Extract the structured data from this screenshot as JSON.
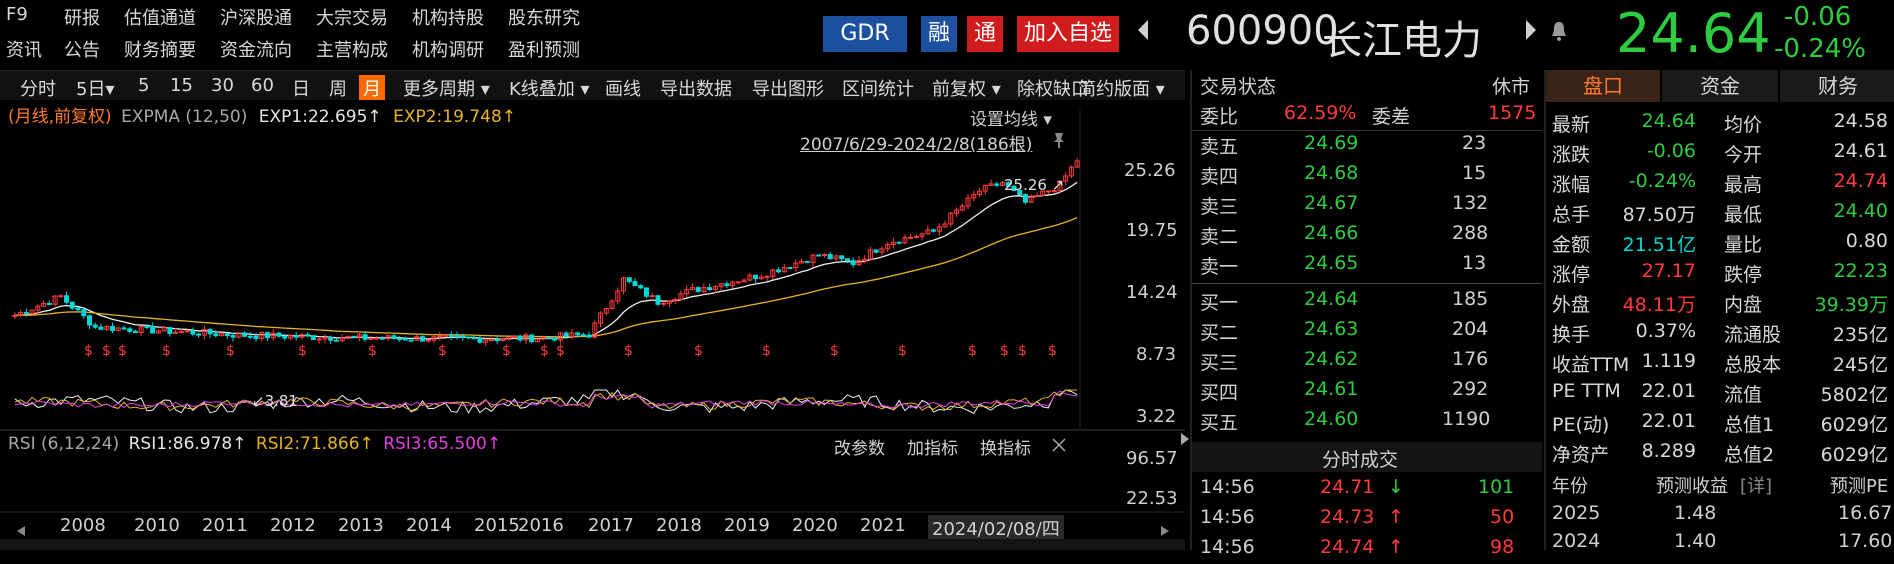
{
  "menu": {
    "row1": [
      "F9",
      "研报",
      "估值通道",
      "沪深股通",
      "大宗交易",
      "机构持股",
      "股东研究"
    ],
    "row2": [
      "资讯",
      "公告",
      "财务摘要",
      "资金流向",
      "主营构成",
      "机构调研",
      "盈利预测"
    ]
  },
  "header": {
    "gdr_label": "GDR",
    "rong_label": "融",
    "tong_label": "通",
    "add_watch_label": "加入自选",
    "code": "600900",
    "name": "长江电力",
    "price": "24.64",
    "change": "-0.06",
    "change_pct": "-0.24%"
  },
  "toolbar": {
    "items": [
      "分时",
      "5日▾",
      "5",
      "15",
      "30",
      "60",
      "日",
      "周",
      "月",
      "更多周期 ▾",
      "K线叠加 ▾",
      "画线",
      "导出数据",
      "导出图形",
      "区间统计",
      "前复权 ▾",
      "除权缺口",
      "简约版面 ▾"
    ]
  },
  "chart": {
    "legend_prefix": "(月线,前复权)",
    "legend_name": "EXPMA (12,50)",
    "exp1": "EXP1:22.695↑",
    "exp2": "EXP2:19.748↑",
    "set_ma": "设置均线 ▾",
    "range": "2007/6/29-2024/2/8(186根)",
    "price_labels": [
      "25.26",
      "19.75",
      "14.24",
      "8.73",
      "3.22"
    ],
    "high_label": "25.26",
    "low_label": "3.81",
    "dividend_mark": "$",
    "rsi_label": "RSI (6,12,24)",
    "rsi1": "RSI1:86.978↑",
    "rsi2": "RSI2:71.866↑",
    "rsi3": "RSI3:65.500↑",
    "rsi_btn_params": "改参数",
    "rsi_btn_add": "加指标",
    "rsi_btn_switch": "换指标",
    "rsi_axis": [
      "96.57",
      "22.53"
    ],
    "years": [
      "2008",
      "2010",
      "2011",
      "2012",
      "2013",
      "2014",
      "2015",
      "2016",
      "2017",
      "2018",
      "2019",
      "2020",
      "2021"
    ],
    "cursor_date": "2024/02/08/四"
  },
  "orderbook": {
    "status_label": "交易状态",
    "status_value": "休市",
    "weibi_label": "委比",
    "weibi_value": "62.59%",
    "weicha_label": "委差",
    "weicha_value": "1575",
    "asks": [
      {
        "label": "卖五",
        "price": "24.69",
        "vol": "23"
      },
      {
        "label": "卖四",
        "price": "24.68",
        "vol": "15"
      },
      {
        "label": "卖三",
        "price": "24.67",
        "vol": "132"
      },
      {
        "label": "卖二",
        "price": "24.66",
        "vol": "288"
      },
      {
        "label": "卖一",
        "price": "24.65",
        "vol": "13"
      }
    ],
    "bids": [
      {
        "label": "买一",
        "price": "24.64",
        "vol": "185"
      },
      {
        "label": "买二",
        "price": "24.63",
        "vol": "204"
      },
      {
        "label": "买三",
        "price": "24.62",
        "vol": "176"
      },
      {
        "label": "买四",
        "price": "24.61",
        "vol": "292"
      },
      {
        "label": "买五",
        "price": "24.60",
        "vol": "1190"
      }
    ],
    "ticks_title": "分时成交",
    "ticks": [
      {
        "time": "14:56",
        "price": "24.71",
        "arrow": "↓",
        "vol": "101"
      },
      {
        "time": "14:56",
        "price": "24.73",
        "arrow": "↑",
        "vol": "50"
      },
      {
        "time": "14:56",
        "price": "24.74",
        "arrow": "↑",
        "vol": "98"
      }
    ]
  },
  "quote": {
    "tabs": [
      "盘口",
      "资金",
      "财务"
    ],
    "rows": [
      {
        "l1": "最新",
        "v1": "24.64",
        "l2": "均价",
        "v2": "24.58"
      },
      {
        "l1": "涨跌",
        "v1": "-0.06",
        "l2": "今开",
        "v2": "24.61"
      },
      {
        "l1": "涨幅",
        "v1": "-0.24%",
        "l2": "最高",
        "v2": "24.74"
      },
      {
        "l1": "总手",
        "v1": "87.50万",
        "l2": "最低",
        "v2": "24.40"
      },
      {
        "l1": "金额",
        "v1": "21.51亿",
        "l2": "量比",
        "v2": "0.80"
      },
      {
        "l1": "涨停",
        "v1": "27.17",
        "l2": "跌停",
        "v2": "22.23"
      },
      {
        "l1": "外盘",
        "v1": "48.11万",
        "l2": "内盘",
        "v2": "39.39万"
      },
      {
        "l1": "换手",
        "v1": "0.37%",
        "l2": "流通股",
        "v2": "235亿"
      },
      {
        "l1": "收益TTM",
        "v1": "1.119",
        "l2": "总股本",
        "v2": "245亿"
      },
      {
        "l1": "PE TTM",
        "v1": "22.01",
        "l2": "流值",
        "v2": "5802亿"
      },
      {
        "l1": "PE(动)",
        "v1": "22.01",
        "l2": "总值1",
        "v2": "6029亿"
      },
      {
        "l1": "净资产",
        "v1": "8.289",
        "l2": "总值2",
        "v2": "6029亿"
      }
    ],
    "forecast_head": {
      "year": "年份",
      "eps": "预测收益",
      "detail": "[详]",
      "pe": "预测PE"
    },
    "forecast": [
      {
        "year": "2025",
        "eps": "1.48",
        "pe": "16.67"
      },
      {
        "year": "2024",
        "eps": "1.40",
        "pe": "17.60"
      }
    ]
  },
  "colors": {
    "up": "#ff3b3b",
    "down": "#2ecc40",
    "accent": "#ff6a00",
    "brand_blue": "#1e50a0"
  }
}
